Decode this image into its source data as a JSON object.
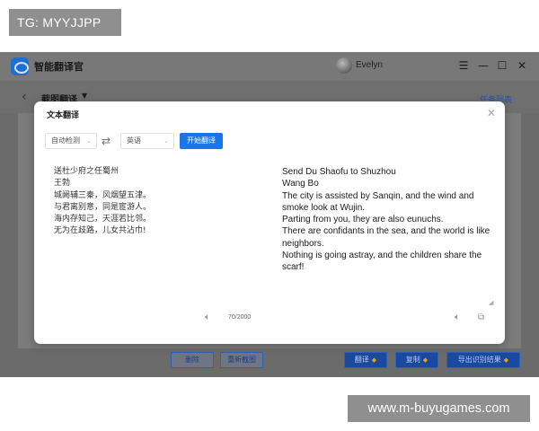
{
  "watermark_top": "TG: MYYJJPP",
  "watermark_bottom": "www.m-buyugames.com",
  "app": {
    "title": "智能翻译官",
    "user": "Evelyn",
    "icons": [
      "app-logo-icon",
      "menu-icon",
      "minimize-icon",
      "maximize-icon",
      "close-icon"
    ]
  },
  "subbar": {
    "title": "截图翻译",
    "right_link": "任务列表"
  },
  "bottom_buttons": {
    "delete": "删除",
    "recapture": "重新截图",
    "translate": "翻译",
    "copy": "复制",
    "export": "导出识别结果"
  },
  "modal": {
    "title": "文本翻译",
    "source_lang": "自动检测",
    "target_lang": "英语",
    "start_button": "开始翻译",
    "source_lines": [
      "送杜少府之任蜀州",
      "王勃",
      "城阙辅三秦，风烟望五津。",
      "与君离别意，同是宦游人。",
      "海内存知己，天涯若比邻。",
      "无为在歧路，儿女共沾巾!"
    ],
    "target_lines": [
      "Send Du Shaofu to Shuzhou",
      "Wang Bo",
      "The city is assisted by Sanqin, and the wind and smoke look at Wujin.",
      "Parting from you, they are also eunuchs.",
      "There are confidants in the sea, and the world is like neighbors.",
      "Nothing is going astray, and the children share the scarf!"
    ],
    "char_count": "70/2000"
  }
}
